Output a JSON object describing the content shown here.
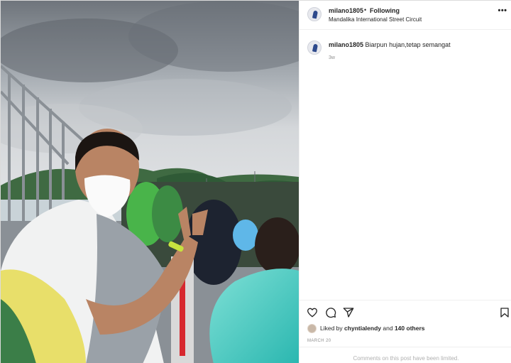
{
  "post": {
    "username": "milano1805",
    "follow_status": "Following",
    "separator": "•",
    "location": "Mandalika International Street Circuit",
    "more_icon": "more-options-icon",
    "caption": {
      "username": "milano1805",
      "text": "Biarpun hujan,tetap semangat",
      "age": "3w"
    },
    "likes": {
      "prefix": "Liked by",
      "user": "chyntialendy",
      "joiner": "and",
      "others": "140 others"
    },
    "date": "MARCH 20",
    "comments_notice": "Comments on this post have been limited."
  },
  "icons": {
    "like": "heart-icon",
    "comment": "comment-icon",
    "share": "send-icon",
    "save": "bookmark-icon"
  },
  "colors": {
    "text": "#262626",
    "muted": "#8e8e8e",
    "border": "#efefef"
  }
}
